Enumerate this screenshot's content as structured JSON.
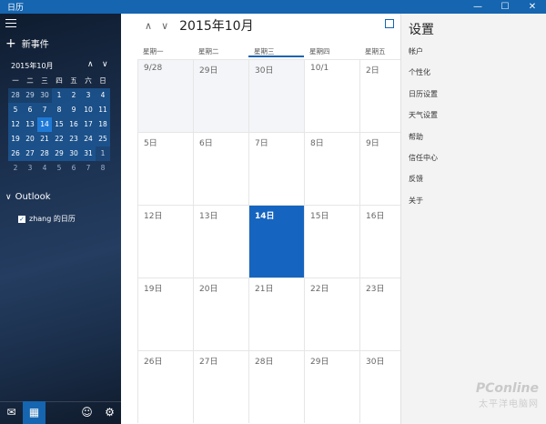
{
  "window": {
    "title": "日历",
    "controls": {
      "minimize": "—",
      "maximize": "☐",
      "close": "✕"
    }
  },
  "sidebar": {
    "new_event": "新事件",
    "mini_calendar": {
      "month_title": "2015年10月",
      "prev_symbol": "∧",
      "next_symbol": "∨",
      "weekday_headers": [
        "一",
        "二",
        "三",
        "四",
        "五",
        "六",
        "日"
      ],
      "weeks": [
        [
          "28",
          "29",
          "30",
          "1",
          "2",
          "3",
          "4"
        ],
        [
          "5",
          "6",
          "7",
          "8",
          "9",
          "10",
          "11"
        ],
        [
          "12",
          "13",
          "14",
          "15",
          "16",
          "17",
          "18"
        ],
        [
          "19",
          "20",
          "21",
          "22",
          "23",
          "24",
          "25"
        ],
        [
          "26",
          "27",
          "28",
          "29",
          "30",
          "31",
          "1"
        ],
        [
          "2",
          "3",
          "4",
          "5",
          "6",
          "7",
          "8"
        ]
      ]
    },
    "account_group": "Outlook",
    "calendar_entry": "zhang 的日历"
  },
  "main": {
    "month_title": "2015年10月",
    "weekdays": [
      "星期一",
      "星期二",
      "星期三",
      "星期四",
      "星期五"
    ],
    "weeks": [
      [
        "9/28",
        "29日",
        "30日",
        "10/1",
        "2日"
      ],
      [
        "5日",
        "6日",
        "7日",
        "8日",
        "9日"
      ],
      [
        "12日",
        "13日",
        "14日",
        "15日",
        "16日"
      ],
      [
        "19日",
        "20日",
        "21日",
        "22日",
        "23日"
      ],
      [
        "26日",
        "27日",
        "28日",
        "29日",
        "30日"
      ]
    ]
  },
  "settings": {
    "title": "设置",
    "items": [
      "帐户",
      "个性化",
      "日历设置",
      "天气设置",
      "帮助",
      "信任中心",
      "反馈",
      "关于"
    ]
  },
  "watermark": {
    "brand": "PConline",
    "subtitle": "太平洋电脑网"
  },
  "colors": {
    "accent": "#1565b0",
    "today": "#1565c0"
  }
}
